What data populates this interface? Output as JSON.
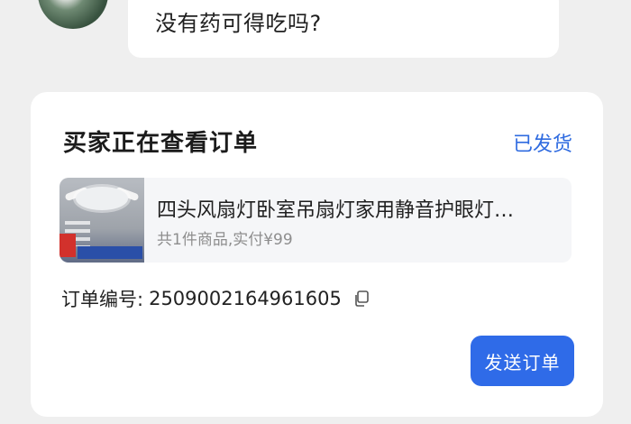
{
  "chat": {
    "message_text": "没有药可得吃吗?"
  },
  "order_card": {
    "title": "买家正在查看订单",
    "status": "已发货",
    "product": {
      "name": "四头风扇灯卧室吊扇灯家用静音护眼灯…",
      "summary": "共1件商品,实付¥99"
    },
    "order_number_label": "订单编号:",
    "order_number": "2509002164961605",
    "send_button": "发送订单"
  },
  "colors": {
    "accent": "#2f6be8",
    "background": "#efefef",
    "card": "#ffffff"
  },
  "icons": [
    "avatar",
    "copy-icon"
  ]
}
